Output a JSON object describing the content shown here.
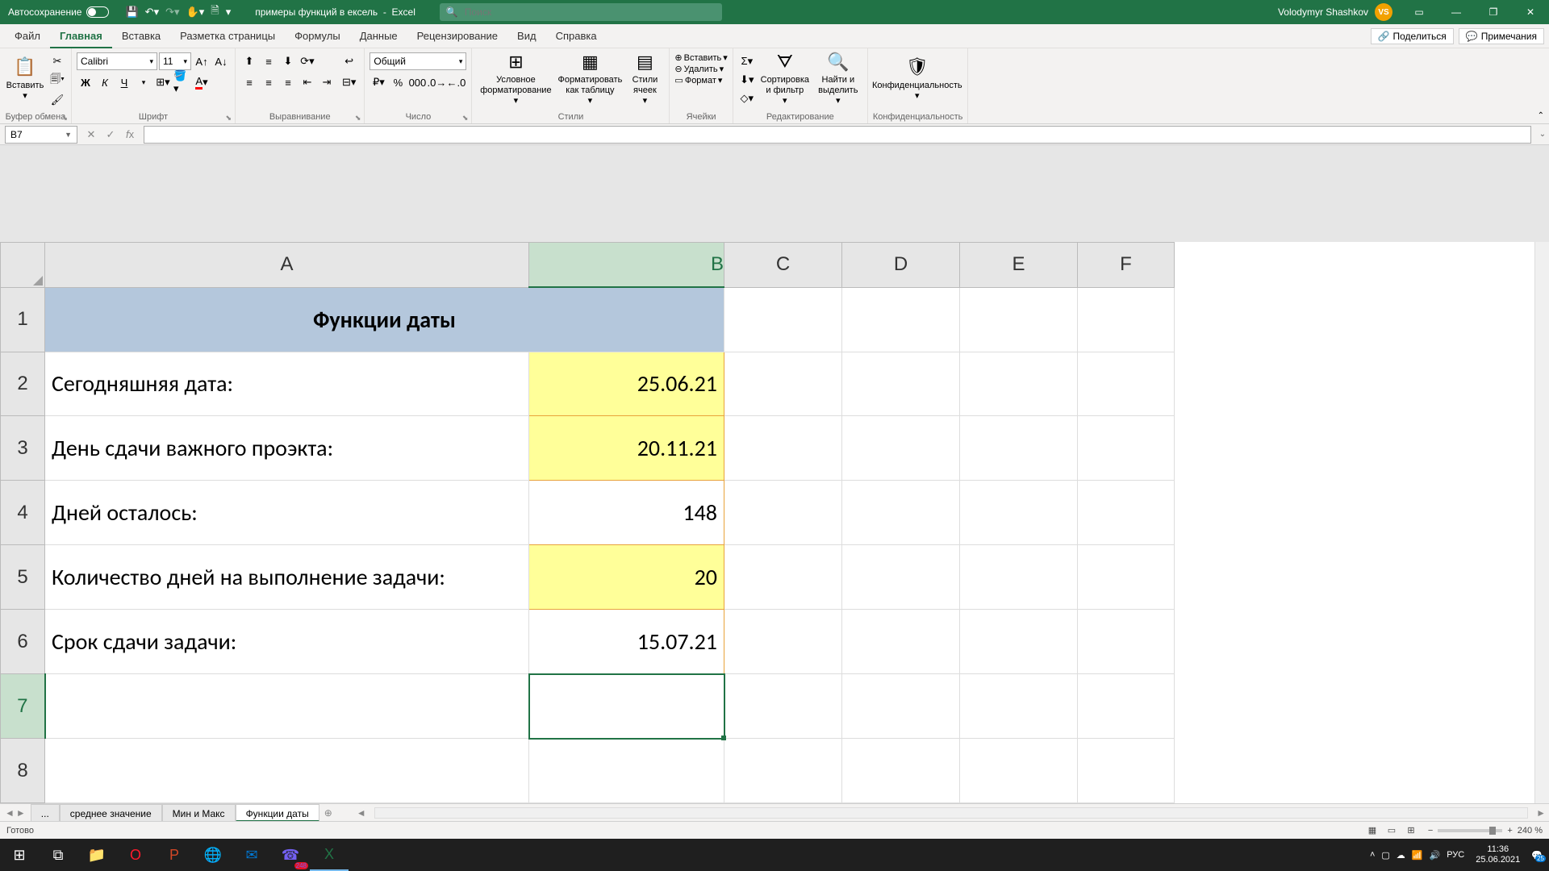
{
  "titlebar": {
    "autosave": "Автосохранение",
    "filename": "примеры функций в ексель",
    "app": "Excel",
    "search_placeholder": "Поиск",
    "user": "Volodymyr Shashkov",
    "user_initials": "VS"
  },
  "ribbon_tabs": {
    "file": "Файл",
    "home": "Главная",
    "insert": "Вставка",
    "layout": "Разметка страницы",
    "formulas": "Формулы",
    "data": "Данные",
    "review": "Рецензирование",
    "view": "Вид",
    "help": "Справка",
    "share": "Поделиться",
    "comments": "Примечания"
  },
  "ribbon": {
    "clipboard": {
      "paste": "Вставить",
      "label": "Буфер обмена"
    },
    "font": {
      "name": "Calibri",
      "size": "11",
      "label": "Шрифт",
      "bold": "Ж",
      "italic": "К",
      "underline": "Ч"
    },
    "align": {
      "label": "Выравнивание"
    },
    "number": {
      "format": "Общий",
      "label": "Число"
    },
    "styles": {
      "conditional": "Условное форматирование",
      "table": "Форматировать как таблицу",
      "cellstyles": "Стили ячеек",
      "label": "Стили"
    },
    "cells": {
      "insert": "Вставить",
      "delete": "Удалить",
      "format": "Формат",
      "label": "Ячейки"
    },
    "editing": {
      "sort": "Сортировка и фильтр",
      "find": "Найти и выделить",
      "label": "Редактирование"
    },
    "sens": {
      "btn": "Конфиденциальность",
      "label": "Конфиденциальность"
    }
  },
  "namebox": "B7",
  "columns": {
    "A": "A",
    "B": "B",
    "C": "C",
    "D": "D",
    "E": "E",
    "F": "F"
  },
  "rows": {
    "r1": "1",
    "r2": "2",
    "r3": "3",
    "r4": "4",
    "r5": "5",
    "r6": "6",
    "r7": "7",
    "r8": "8"
  },
  "cells": {
    "header": "Функции даты",
    "a2": "Сегодняшняя дата:",
    "b2": "25.06.21",
    "a3": "День сдачи важного проэкта:",
    "b3": "20.11.21",
    "a4": "Дней осталось:",
    "b4": "148",
    "a5": "Количество дней на выполнение задачи:",
    "b5": "20",
    "a6": "Срок сдачи задачи:",
    "b6": "15.07.21"
  },
  "sheets": {
    "more": "...",
    "s1": "среднее значение",
    "s2": "Мин и Макс",
    "s3": "Функции даты"
  },
  "statusbar": {
    "ready": "Готово",
    "zoom": "240 %"
  },
  "taskbar": {
    "lang": "РУС",
    "time": "11:36",
    "date": "25.06.2021",
    "badge": "25",
    "viber_badge": "248"
  }
}
